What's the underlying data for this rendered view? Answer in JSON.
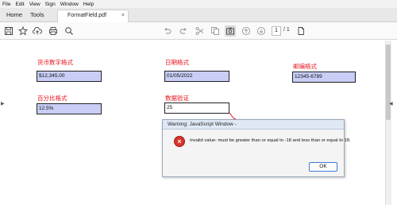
{
  "menu": [
    "File",
    "Edit",
    "View",
    "Sign",
    "Window",
    "Help"
  ],
  "tabs": {
    "home": "Home",
    "tools": "Tools",
    "document": "FormatField.pdf",
    "close": "×"
  },
  "toolbar": {
    "current_page": "1",
    "page_total": "/ 1",
    "icons": [
      "save-icon",
      "bookmark-star-icon",
      "upload-icon",
      "print-icon",
      "zoom-icon",
      "undo-icon",
      "redo-icon",
      "cut-icon",
      "copy-icon",
      "snapshot-icon",
      "page-up-icon",
      "page-down-icon",
      "page-icon"
    ]
  },
  "form": {
    "currency_label": "货币数字格式",
    "currency_value": "$12,345.00",
    "date_label": "日期格式",
    "date_value": "01/05/2022",
    "zip_label": "邮编格式",
    "zip_value": "12345-6789",
    "percent_label": "百分比格式",
    "percent_value": "12.5%",
    "validate_label": "数据验证",
    "validate_value": "25"
  },
  "dialog": {
    "title": "Warning: JavaScript Window -",
    "message": "Invalid value: must be greater than or equal to -18 and less than or equal to 18.",
    "ok_label": "OK",
    "icon": "error-icon"
  },
  "colors": {
    "label_red": "#e8121b",
    "field_fill": "#c8cef5",
    "error_red": "#d8322a"
  }
}
